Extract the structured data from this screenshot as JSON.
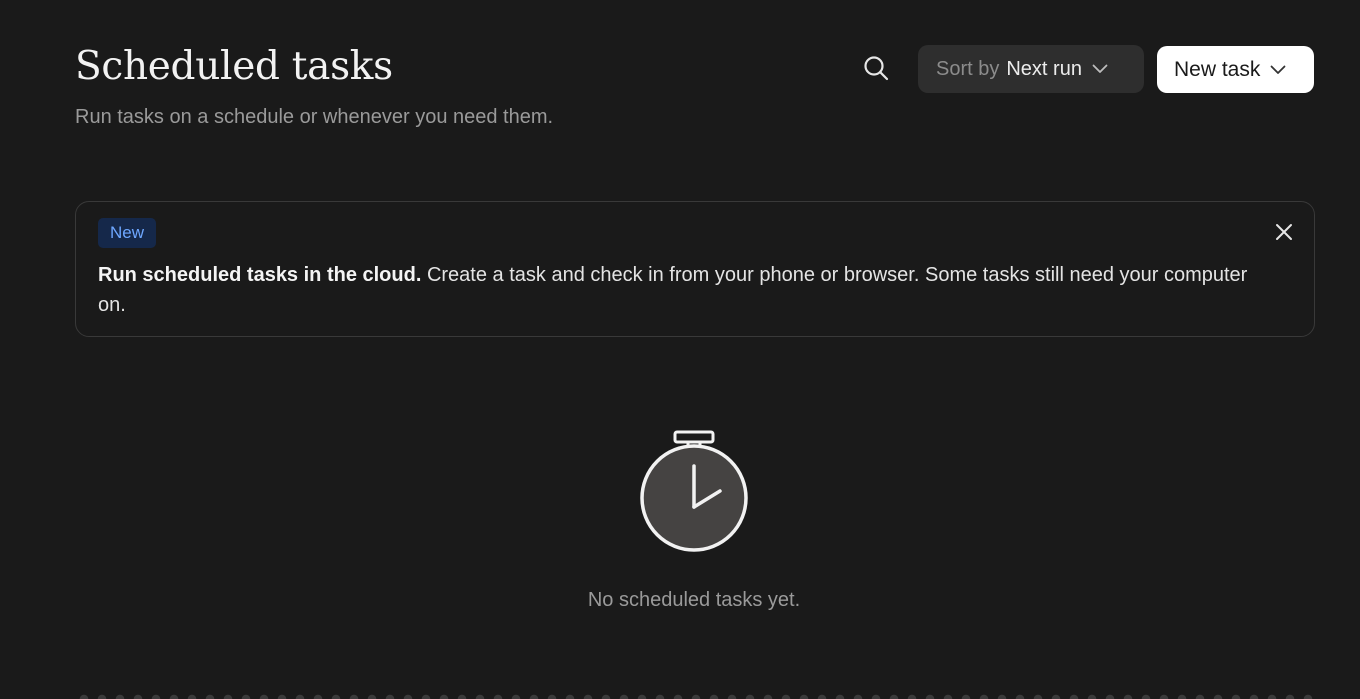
{
  "header": {
    "title": "Scheduled tasks",
    "subtitle": "Run tasks on a schedule or whenever you need them."
  },
  "toolbar": {
    "search_icon": "search-icon",
    "sort_prefix": "Sort by",
    "sort_value": "Next run",
    "new_task_label": "New task"
  },
  "banner": {
    "badge": "New",
    "heading": "Run scheduled tasks in the cloud.",
    "body": " Create a task and check in from your phone or browser. Some tasks still need your computer on."
  },
  "empty_state": {
    "icon": "stopwatch-icon",
    "message": "No scheduled tasks yet."
  },
  "colors": {
    "background": "#1a1a1a",
    "badge_bg": "#15284a",
    "badge_text": "#6ea7ff",
    "sort_bg": "#2e2e2e",
    "primary_button_bg": "#ffffff"
  }
}
